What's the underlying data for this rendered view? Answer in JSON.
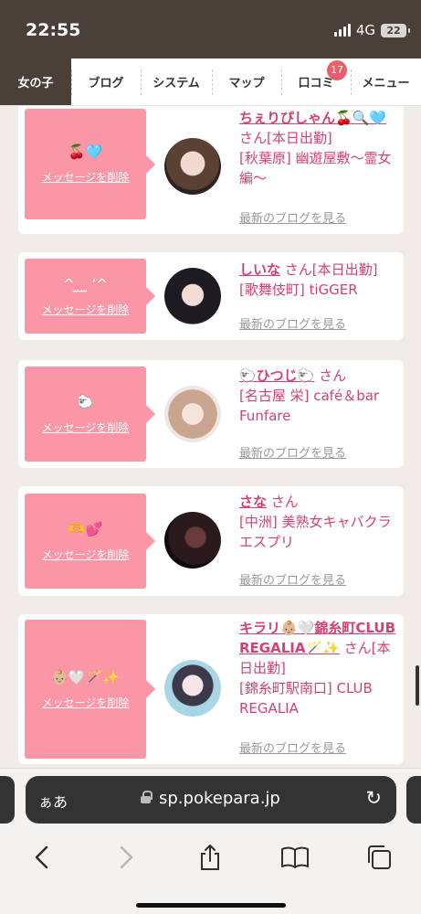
{
  "status": {
    "time": "22:55",
    "network": "4G",
    "battery": "22"
  },
  "nav": {
    "tabs": [
      {
        "label": "女の子",
        "active": true
      },
      {
        "label": "ブログ"
      },
      {
        "label": "システム"
      },
      {
        "label": "マップ"
      },
      {
        "label": "口コミ",
        "badge": "17"
      },
      {
        "label": "メニュー"
      }
    ]
  },
  "cards": [
    {
      "emoji": "🍒🩵",
      "delete_label": "メッセージを削除",
      "name": "ちぇりぴしゃん🍒🔍🩵",
      "suffix": "さん[本日出勤]",
      "place": "[秋葉原] 幽遊屋敷～霊女編～",
      "blog_link": "最新のブログを見る"
    },
    {
      "emoji": "^ ̫ ̮ ̫ ʼ^",
      "delete_label": "メッセージを削除",
      "name": "しいな",
      "suffix": "さん[本日出勤]",
      "place": "[歌舞伎町] tiGGER",
      "blog_link": "最新のブログを見る"
    },
    {
      "emoji": "🐑",
      "delete_label": "メッセージを削除",
      "name": "🐑ひつじ🐑",
      "suffix": "さん",
      "place": "[名古屋 栄] café＆bar Funfare",
      "blog_link": "最新のブログを見る"
    },
    {
      "emoji": "🫶💕",
      "delete_label": "メッセージを削除",
      "name": "さな",
      "suffix": "さん",
      "place": "[中洲] 美熟女キャバクラ エスプリ",
      "blog_link": "最新のブログを見る"
    },
    {
      "emoji": "👶🏼🤍🪄✨",
      "delete_label": "メッセージを削除",
      "name": "キラリ👶🏼🤍錦糸町CLUB REGALIA🪄✨",
      "suffix": "さん[本日出勤]",
      "place": "[錦糸町駅南口] CLUB REGALIA",
      "blog_link": "最新のブログを見る"
    }
  ],
  "browser": {
    "text_size_label": "ぁあ",
    "url": "sp.pokepara.jp"
  },
  "icons": {
    "reload": "reload-icon",
    "back": "back-icon",
    "forward": "forward-icon",
    "share": "share-icon",
    "bookmarks": "bookmarks-icon",
    "tabs": "tabs-icon"
  },
  "colors": {
    "accent_pink": "#fa96a5",
    "link_pink": "#d73f72",
    "nav_dark": "#4a3f39"
  }
}
